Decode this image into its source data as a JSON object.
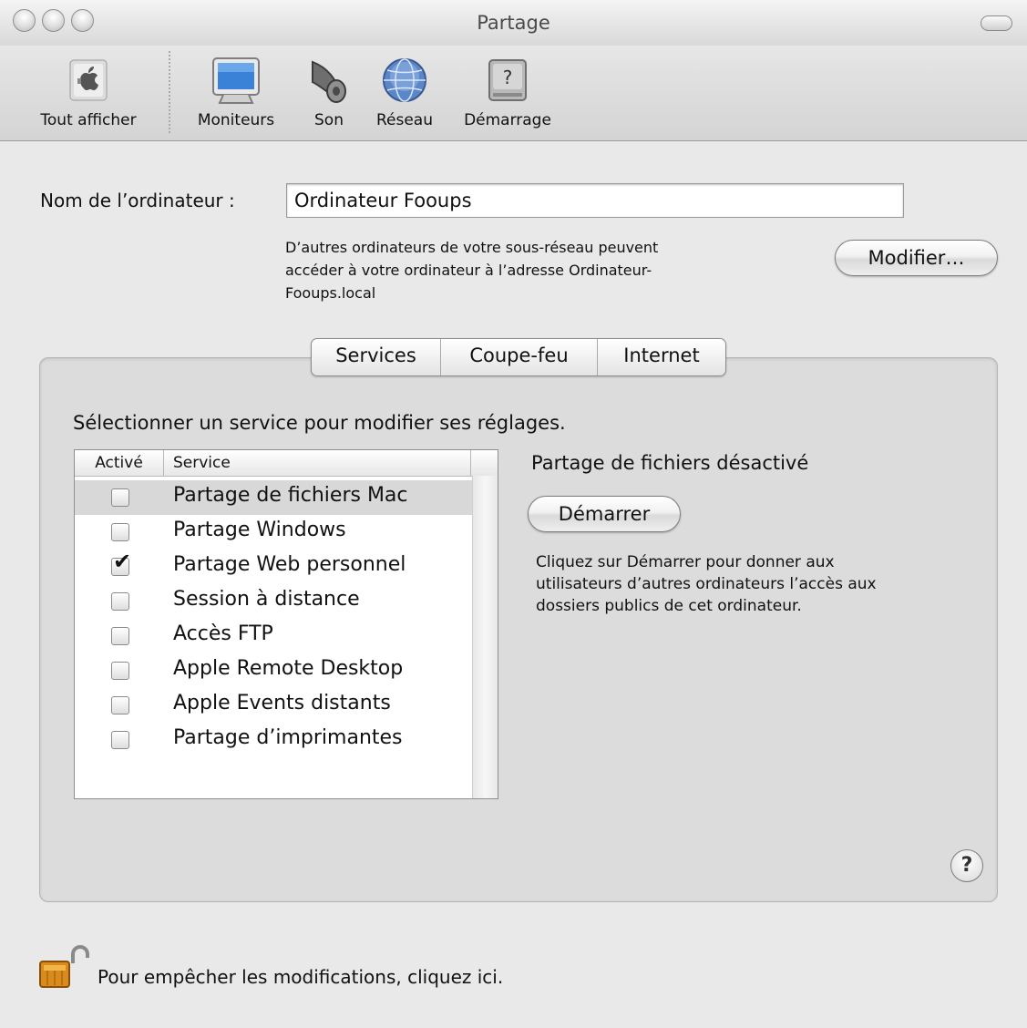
{
  "window": {
    "title": "Partage"
  },
  "toolbar": {
    "items": [
      {
        "label": "Tout afficher",
        "icon": "apple-logo-icon"
      },
      {
        "label": "Moniteurs",
        "icon": "monitor-icon"
      },
      {
        "label": "Son",
        "icon": "speaker-icon"
      },
      {
        "label": "Réseau",
        "icon": "globe-icon"
      },
      {
        "label": "Démarrage",
        "icon": "startup-disk-icon"
      }
    ]
  },
  "computer_name": {
    "label": "Nom de l’ordinateur :",
    "value": "Ordinateur Fooups",
    "info_line1": "D’autres ordinateurs de votre sous-réseau peuvent",
    "info_line2": "accéder à votre ordinateur à l’adresse Ordinateur-",
    "info_line3": "Fooups.local",
    "edit_button": "Modifier…"
  },
  "tabs": [
    "Services",
    "Coupe-feu",
    "Internet"
  ],
  "services": {
    "instruction": "Sélectionner un service pour modifier ses réglages.",
    "columns": {
      "active": "Activé",
      "service": "Service"
    },
    "rows": [
      {
        "name": "Partage de fichiers Mac",
        "checked": false,
        "selected": true
      },
      {
        "name": "Partage Windows",
        "checked": false,
        "selected": false
      },
      {
        "name": "Partage Web personnel",
        "checked": true,
        "selected": false
      },
      {
        "name": "Session à distance",
        "checked": false,
        "selected": false
      },
      {
        "name": "Accès FTP",
        "checked": false,
        "selected": false
      },
      {
        "name": "Apple Remote Desktop",
        "checked": false,
        "selected": false
      },
      {
        "name": "Apple Events distants",
        "checked": false,
        "selected": false
      },
      {
        "name": "Partage d’imprimantes",
        "checked": false,
        "selected": false
      }
    ],
    "status": "Partage de fichiers désactivé",
    "start_button": "Démarrer",
    "desc_line1": "Cliquez sur Démarrer pour donner aux",
    "desc_line2": "utilisateurs d’autres ordinateurs l’accès aux",
    "desc_line3": "dossiers publics de cet ordinateur."
  },
  "help": {
    "symbol": "?"
  },
  "lock": {
    "text": "Pour empêcher les modifications, cliquez ici."
  }
}
